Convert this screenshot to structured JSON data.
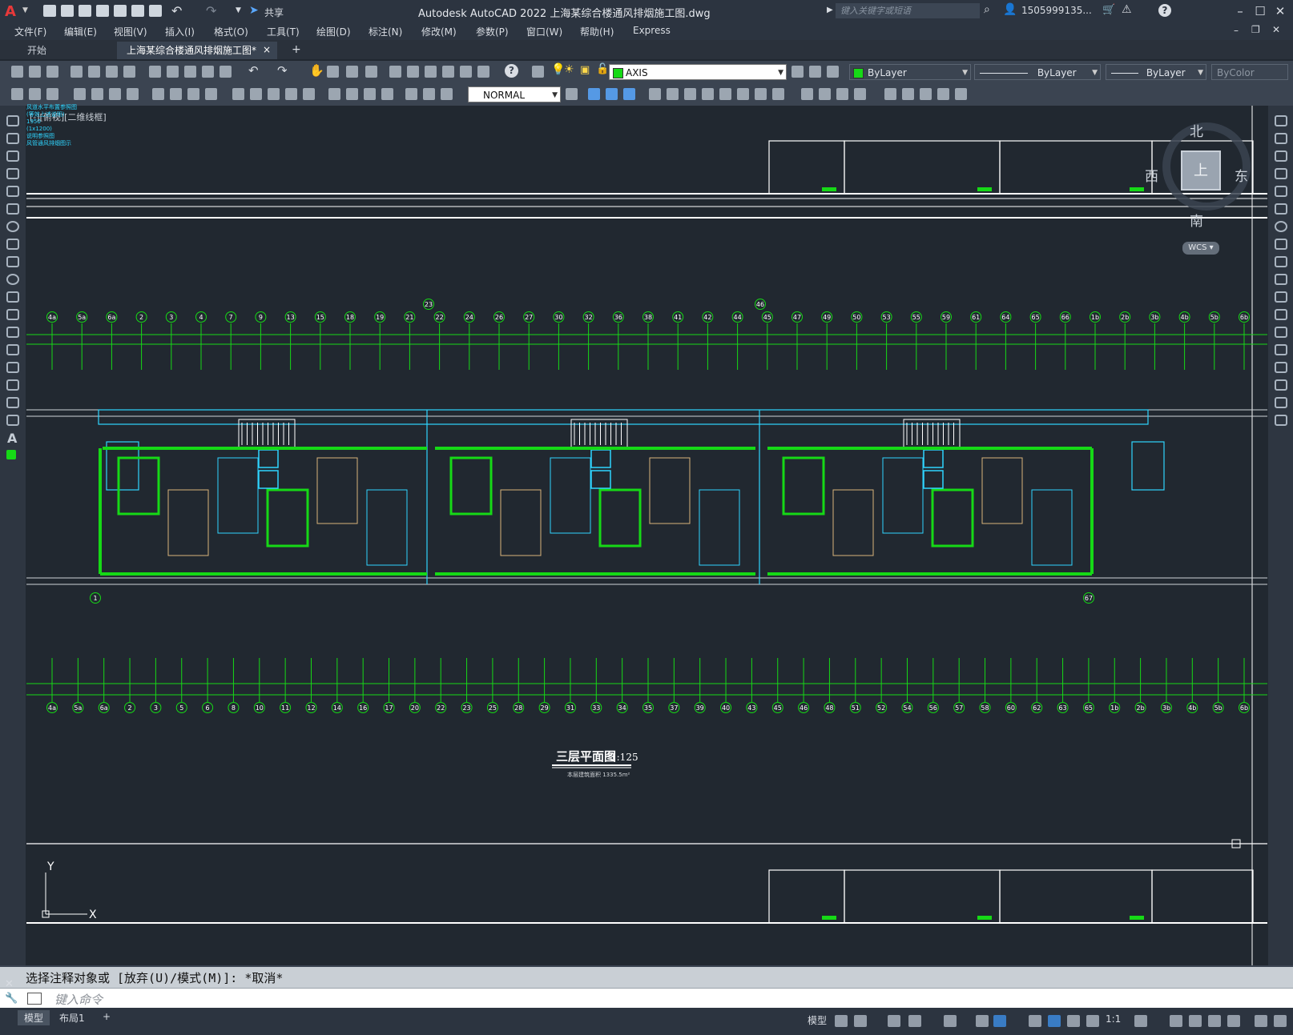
{
  "app": {
    "logo": "A",
    "title": "Autodesk AutoCAD 2022    上海某综合楼通风排烟施工图.dwg",
    "share_label": "共享",
    "search_placeholder": "键入关键字或短语",
    "user": "1505999135...",
    "help": "?"
  },
  "menu": [
    "文件(F)",
    "编辑(E)",
    "视图(V)",
    "插入(I)",
    "格式(O)",
    "工具(T)",
    "绘图(D)",
    "标注(N)",
    "修改(M)",
    "参数(P)",
    "窗口(W)",
    "帮助(H)",
    "Express"
  ],
  "tabs": {
    "start": "开始",
    "active": "上海某综合楼通风排烟施工图*",
    "close": "×",
    "add": "+"
  },
  "props": {
    "layer": "AXIS",
    "color": "ByLayer",
    "linetype": "ByLayer",
    "lineweight": "ByLayer",
    "plotstyle": "ByColor",
    "textstyle": "NORMAL"
  },
  "canvas": {
    "view_label": "[-][俯视][二维线框]",
    "notes": [
      "风道水平布置参照图",
      "(等效上述说明)",
      "1950",
      "(1x1200)",
      "说明参照图",
      "风管通风排烟图示"
    ],
    "compass": {
      "n": "北",
      "s": "南",
      "w": "西",
      "e": "东",
      "top": "上",
      "wcs": "WCS"
    },
    "drawing_title": "三层平面图",
    "drawing_scale": "1:125",
    "drawing_subtitle": "本层建筑面积 1335.5m²",
    "axis_top": [
      "4a",
      "5a",
      "6a",
      "2",
      "3",
      "4",
      "7",
      "9",
      "13",
      "15",
      "18",
      "19",
      "21",
      "22",
      "24",
      "26",
      "27",
      "30",
      "32",
      "36",
      "38",
      "41",
      "42",
      "44",
      "45",
      "47",
      "49",
      "50",
      "53",
      "55",
      "59",
      "61",
      "64",
      "65",
      "66",
      "1b",
      "2b",
      "3b",
      "4b",
      "5b",
      "6b"
    ],
    "axis_bottom": [
      "4a",
      "5a",
      "6a",
      "2",
      "3",
      "5",
      "6",
      "8",
      "10",
      "11",
      "12",
      "14",
      "16",
      "17",
      "20",
      "22",
      "23",
      "25",
      "28",
      "29",
      "31",
      "33",
      "34",
      "35",
      "37",
      "39",
      "40",
      "43",
      "45",
      "46",
      "48",
      "51",
      "52",
      "54",
      "56",
      "57",
      "58",
      "60",
      "62",
      "63",
      "65",
      "1b",
      "2b",
      "3b",
      "4b",
      "5b",
      "6b"
    ],
    "axis_left": "1",
    "axis_right": "67",
    "axis_23": "23",
    "axis_46": "46",
    "ucs_x": "X",
    "ucs_y": "Y"
  },
  "command": {
    "history": "选择注释对象或 [放弃(U)/模式(M)]: *取消*",
    "placeholder": "键入命令"
  },
  "status": {
    "tab_model": "模型",
    "tab_layout1": "布局1",
    "add": "+",
    "model_space": "模型",
    "scale": "1:1"
  }
}
